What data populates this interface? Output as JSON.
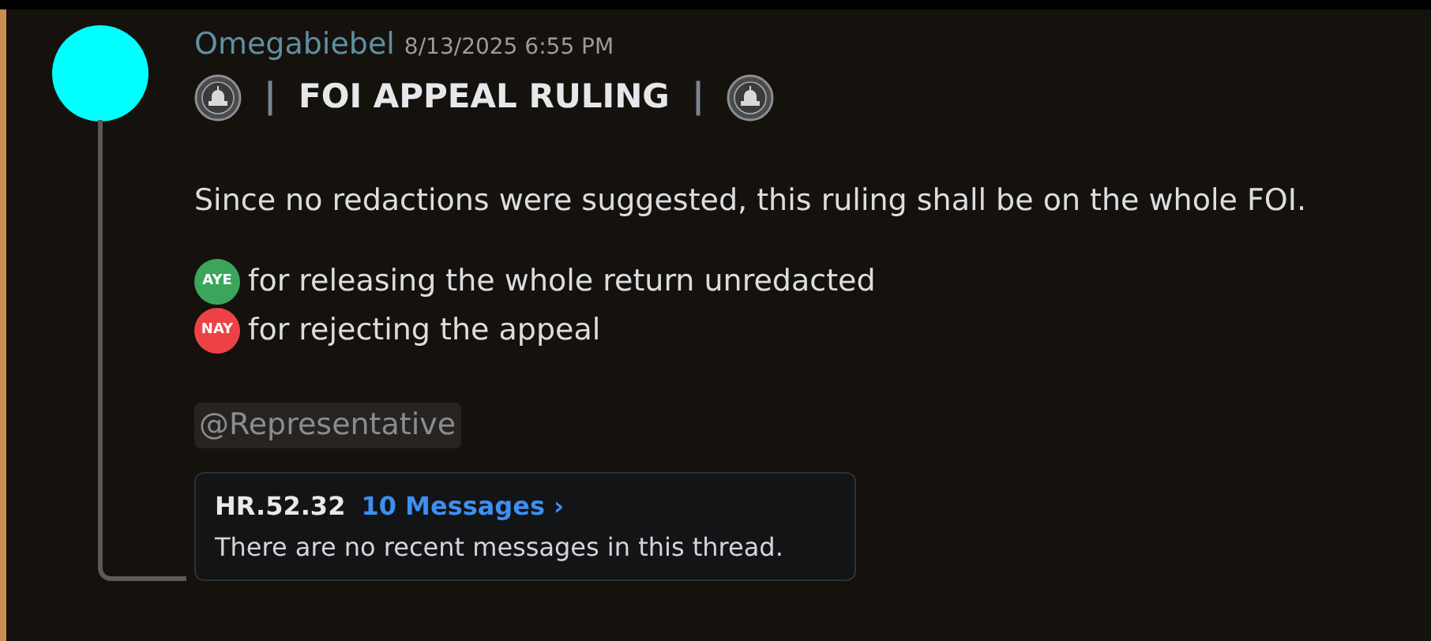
{
  "message": {
    "author": "Omegabiebel",
    "timestamp": "8/13/2025 6:55 PM",
    "title": {
      "separator_left": "|",
      "text": "FOI APPEAL RULING",
      "separator_right": "|"
    },
    "body": "Since no redactions were suggested, this ruling shall be on the whole FOI.",
    "votes": [
      {
        "emoji_label": "AYE",
        "text": "for releasing the whole return unredacted",
        "color": "#3ba55c"
      },
      {
        "emoji_label": "NAY",
        "text": "for rejecting the appeal",
        "color": "#ed4245"
      }
    ],
    "mention": "@Representative",
    "thread": {
      "name": "HR.52.32",
      "count": "10 Messages ›",
      "preview": "There are no recent messages in this thread."
    }
  }
}
